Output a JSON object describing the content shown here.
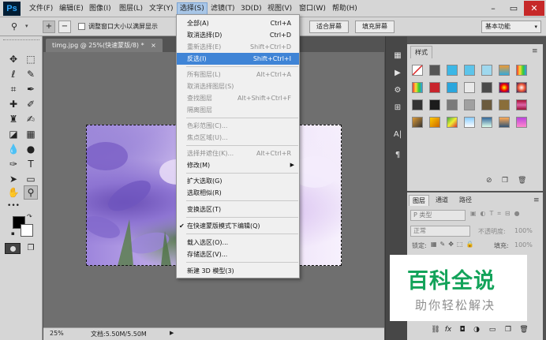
{
  "app": {
    "logo": "Ps"
  },
  "menubar": {
    "items": [
      {
        "label": "文件(F)"
      },
      {
        "label": "编辑(E)"
      },
      {
        "label": "图像(I)"
      },
      {
        "label": "图层(L)"
      },
      {
        "label": "文字(Y)"
      },
      {
        "label": "选择(S)"
      },
      {
        "label": "滤镜(T)"
      },
      {
        "label": "3D(D)"
      },
      {
        "label": "视图(V)"
      },
      {
        "label": "窗口(W)"
      },
      {
        "label": "帮助(H)"
      }
    ],
    "active": "选择(S)",
    "window_controls": {
      "minimize": "–",
      "restore": "▭",
      "close": "✕"
    }
  },
  "options_bar": {
    "checkbox1_label": "调整窗口大小以满屏显示",
    "fit_screen": "适合屏幕",
    "fill_screen": "填充屏幕",
    "workspace": "基本功能"
  },
  "document": {
    "tab_title": "timg.jpg @ 25%(快速蒙版/8) *",
    "tab_close": "×",
    "zoom": "25%",
    "doc_size": "文档:5.50M/5.50M"
  },
  "select_menu": {
    "items": [
      {
        "label": "全部(A)",
        "shortcut": "Ctrl+A",
        "disabled": false
      },
      {
        "label": "取消选择(D)",
        "shortcut": "Ctrl+D",
        "disabled": false
      },
      {
        "label": "重新选择(E)",
        "shortcut": "Shift+Ctrl+D",
        "disabled": true
      },
      {
        "label": "反选(I)",
        "shortcut": "Shift+Ctrl+I",
        "disabled": false,
        "highlight": true
      },
      {
        "label": "所有图层(L)",
        "shortcut": "Alt+Ctrl+A",
        "disabled": true
      },
      {
        "label": "取消选择图层(S)",
        "shortcut": "",
        "disabled": true
      },
      {
        "label": "查找图层",
        "shortcut": "Alt+Shift+Ctrl+F",
        "disabled": true
      },
      {
        "label": "隔离图层",
        "shortcut": "",
        "disabled": true
      },
      {
        "label": "色彩范围(C)...",
        "shortcut": "",
        "disabled": true
      },
      {
        "label": "焦点区域(U)...",
        "shortcut": "",
        "disabled": true
      },
      {
        "label": "选择并遮住(K)...",
        "shortcut": "Alt+Ctrl+R",
        "disabled": true
      },
      {
        "label": "修改(M)",
        "shortcut": "",
        "disabled": false,
        "submenu": true
      },
      {
        "label": "扩大选取(G)",
        "shortcut": "",
        "disabled": false
      },
      {
        "label": "选取相似(R)",
        "shortcut": "",
        "disabled": false
      },
      {
        "label": "变换选区(T)",
        "shortcut": "",
        "disabled": false
      },
      {
        "label": "在快速蒙版模式下编辑(Q)",
        "shortcut": "",
        "disabled": false,
        "checked": true
      },
      {
        "label": "载入选区(O)...",
        "shortcut": "",
        "disabled": false
      },
      {
        "label": "存储选区(V)...",
        "shortcut": "",
        "disabled": false
      },
      {
        "label": "新建 3D 模型(3)",
        "shortcut": "",
        "disabled": false
      }
    ]
  },
  "styles_panel": {
    "tab": "样式"
  },
  "layers_panel": {
    "tabs": [
      {
        "label": "图层"
      },
      {
        "label": "通道"
      },
      {
        "label": "路径"
      }
    ],
    "filter": "P 类型",
    "blend_mode": "正常",
    "opacity_label": "不透明度:",
    "opacity_value": "100%",
    "lock_label": "锁定:",
    "fill_label": "填充:",
    "fill_value": "100%",
    "bottom_icons": [
      "link-icon",
      "fx-icon",
      "mask-icon",
      "adjustment-icon",
      "group-icon",
      "new-layer-icon",
      "trash-icon"
    ]
  },
  "watermark": {
    "title": "百科全说",
    "subtitle": "助你轻松解决"
  },
  "colors": {
    "menu_bg": "#d6d6d6",
    "workspace": "#535353",
    "highlight": "#3f84d6",
    "watermark_green": "#13a35a"
  }
}
